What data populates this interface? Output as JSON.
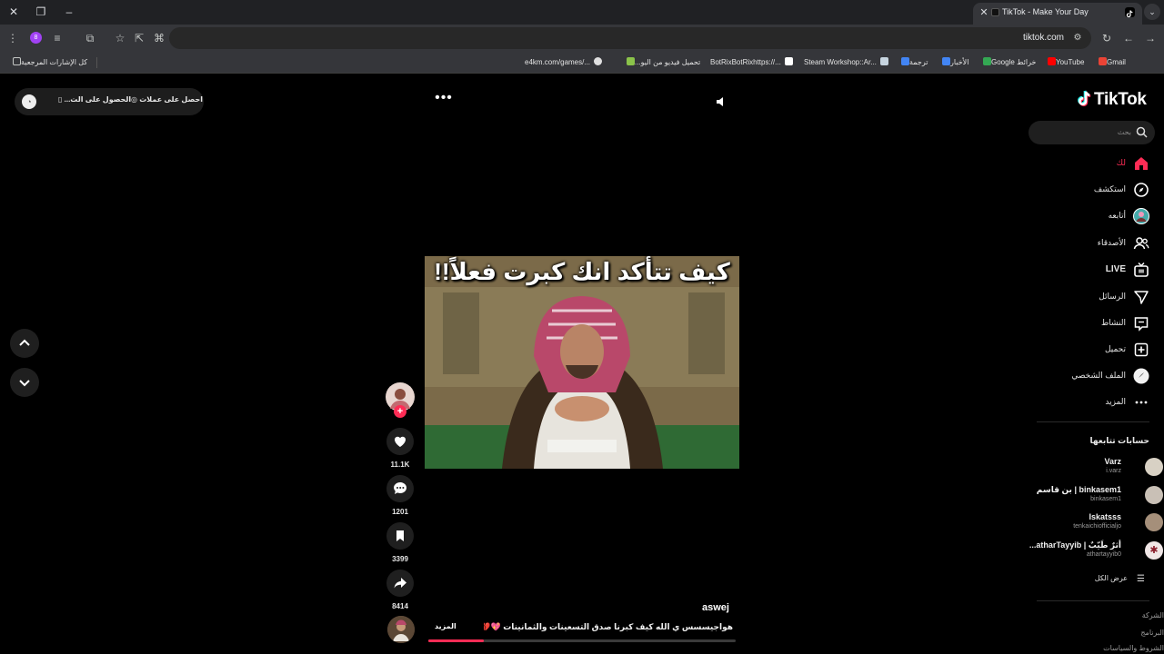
{
  "browser": {
    "tab_title": "TikTok - Make Your Day",
    "url": "tiktok.com",
    "profile_initial": "8",
    "bookmarks": [
      {
        "label": "كل الإشارات المرجعية",
        "icon": "folder-icon"
      },
      {
        "label": "Gmail",
        "icon": "gmail-icon"
      },
      {
        "label": "YouTube",
        "icon": "youtube-icon"
      },
      {
        "label": "خرائط Google",
        "icon": "maps-icon"
      },
      {
        "label": "الأخبار",
        "icon": "news-icon"
      },
      {
        "label": "ترجمة",
        "icon": "translate-icon"
      },
      {
        "label": "Steam Workshop::Ar...",
        "icon": "steam-icon"
      },
      {
        "label": "BotRixBotRixhttps://...",
        "icon": "botrix-icon"
      },
      {
        "label": "تحميل فيديو من اليو...",
        "icon": "download-icon"
      },
      {
        "label": "e4km.com/games/...",
        "icon": "globe-icon"
      }
    ]
  },
  "tiktok": {
    "logo_text": "TikTok",
    "search_placeholder": "بحث",
    "promo": {
      "get_coins": "احصل على عملات",
      "get_app": "الحصول على الت..."
    },
    "nav": [
      {
        "label": "لك",
        "icon": "home-icon",
        "active": true
      },
      {
        "label": "استكشف",
        "icon": "explore-icon",
        "active": false
      },
      {
        "label": "أتابعه",
        "icon": "following-avatar-icon",
        "active": false
      },
      {
        "label": "الأصدقاء",
        "icon": "friends-icon",
        "active": false
      },
      {
        "label": "LIVE",
        "icon": "live-icon",
        "active": false
      },
      {
        "label": "الرسائل",
        "icon": "messages-icon",
        "active": false
      },
      {
        "label": "النشاط",
        "icon": "activity-icon",
        "active": false
      },
      {
        "label": "تحميل",
        "icon": "upload-icon",
        "active": false
      },
      {
        "label": "الملف الشخصي",
        "icon": "profile-icon",
        "active": false
      },
      {
        "label": "المزيد",
        "icon": "more-icon",
        "active": false
      }
    ],
    "following_title": "حسابات تتابعها",
    "following": [
      {
        "name": "Varz",
        "username": "i.varz"
      },
      {
        "name": "binkasem1 | بن قاسم",
        "username": "binkasem1"
      },
      {
        "name": "Iskatsss",
        "username": "tenkaichiofficialjo"
      },
      {
        "name": "أثرٌ طَيّبٌ | atharTayyib...",
        "username": "athartayyib0"
      }
    ],
    "see_all": "عرض الكل",
    "footer_links": [
      "الشركة",
      "البرنامج",
      "الشروط والسياسات"
    ],
    "video": {
      "overlay_text": "كيف تتأكد انك كبرت فعلاً!!",
      "creator": "aswej",
      "description": "هواجيسسس ي الله كيف كبرنا صدق  التسعينات والثمانينات 💖💔 ...",
      "more_label": "المزيد",
      "progress": 0.18,
      "likes": "11.1K",
      "comments": "1201",
      "saves": "3399",
      "shares": "8414"
    }
  }
}
